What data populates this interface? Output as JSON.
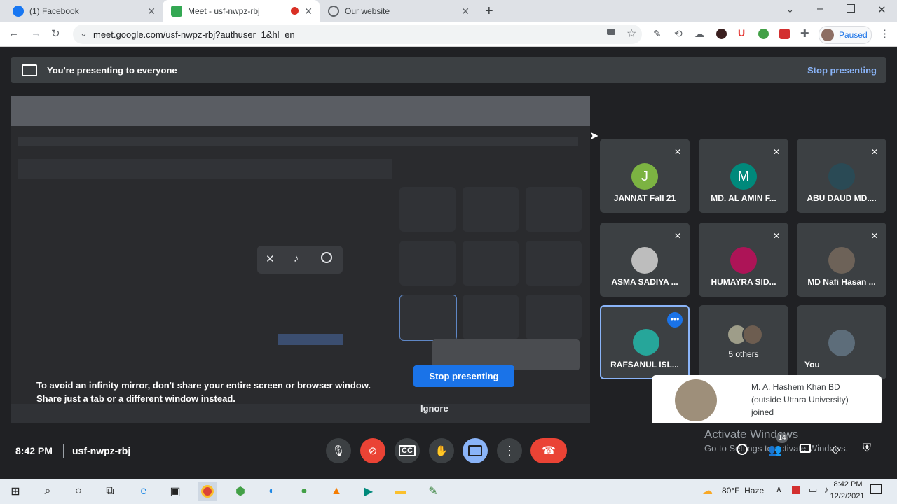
{
  "browser": {
    "tabs": [
      {
        "label": "(1) Facebook",
        "icon": "facebook-icon"
      },
      {
        "label": "Meet - usf-nwpz-rbj",
        "icon": "meet-icon"
      },
      {
        "label": "Our website",
        "icon": "globe-icon"
      }
    ],
    "url": "meet.google.com/usf-nwpz-rbj?authuser=1&hl=en",
    "profile_status": "Paused"
  },
  "banner": {
    "message": "You're presenting to everyone",
    "stop_label": "Stop presenting"
  },
  "mirror_dialog": {
    "warning_line1": "To avoid an infinity mirror, don't share your entire screen or browser window.",
    "warning_line2": "Share just a tab or a different window instead.",
    "stop_label": "Stop presenting",
    "ignore_label": "Ignore"
  },
  "participants": [
    {
      "name": "JANNAT Fall 21",
      "initial": "J",
      "color": "#7cb342",
      "muted": true
    },
    {
      "name": "MD. AL AMIN F...",
      "initial": "M",
      "color": "#00897b",
      "muted": true
    },
    {
      "name": "ABU DAUD MD....",
      "initial": "",
      "color": "#2a4a55",
      "muted": true
    },
    {
      "name": "ASMA SADIYA ...",
      "initial": "",
      "color": "#bdbdbd",
      "muted": true
    },
    {
      "name": "HUMAYRA SID...",
      "initial": "",
      "color": "#ad1457",
      "muted": true
    },
    {
      "name": "MD Nafi Hasan ...",
      "initial": "",
      "color": "#6d6258",
      "muted": true
    },
    {
      "name": "RAFSANUL ISL...",
      "initial": "",
      "color": "#26a69a",
      "muted": false
    },
    {
      "name": "5 others",
      "initial": "",
      "color": "#8d8d7a",
      "muted": false
    },
    {
      "name": "You",
      "initial": "",
      "color": "#5d6d7a",
      "muted": false
    }
  ],
  "toast": {
    "line1": "M. A. Hashem Khan BD",
    "line2": "(outside Uttara University)",
    "line3": "joined"
  },
  "meeting": {
    "time": "8:42 PM",
    "code": "usf-nwpz-rbj",
    "participant_count": "14"
  },
  "activation": {
    "title": "Activate Windows",
    "subtitle": "Go to Settings to activate Windows."
  },
  "taskbar": {
    "weather": "80°F  Haze",
    "time": "8:42 PM",
    "date": "12/2/2021"
  }
}
